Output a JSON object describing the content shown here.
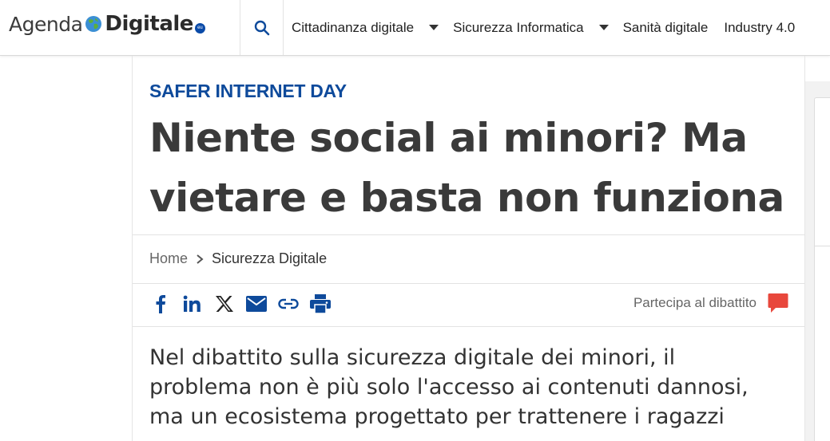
{
  "header": {
    "logo": {
      "part1": "Agenda",
      "part2": "Digitale",
      "suffix": "eu"
    },
    "nav": [
      {
        "label": "Cittadinanza digitale",
        "has_dropdown": true
      },
      {
        "label": "Sicurezza Informatica",
        "has_dropdown": true
      },
      {
        "label": "Sanità digitale",
        "has_dropdown": false
      },
      {
        "label": "Industry 4.0",
        "has_dropdown": false
      }
    ],
    "search_icon": "search-icon"
  },
  "article": {
    "kicker": "SAFER INTERNET DAY",
    "title_line1": "Niente social ai minori? Ma",
    "title_line2": "vietare e basta non funziona",
    "breadcrumb": {
      "home": "Home",
      "separator": ">",
      "current": "Sicurezza Digitale"
    },
    "share_icons": [
      "facebook-icon",
      "linkedin-icon",
      "x-icon",
      "email-icon",
      "link-icon",
      "print-icon"
    ],
    "debate": {
      "label": "Partecipa al dibattito",
      "icon": "comment-icon"
    },
    "lead_line1": "Nel dibattito sulla sicurezza digitale dei minori, il",
    "lead_line2": "problema non è più solo l'accesso ai contenuti dannosi,",
    "lead_line3": "ma un ecosistema progettato per trattenere i ragazzi"
  },
  "colors": {
    "brand_blue": "#0e4a9b",
    "share_blue": "#0e4a9b",
    "debate_red": "#e8473c",
    "title_text": "#3a3a3a"
  }
}
